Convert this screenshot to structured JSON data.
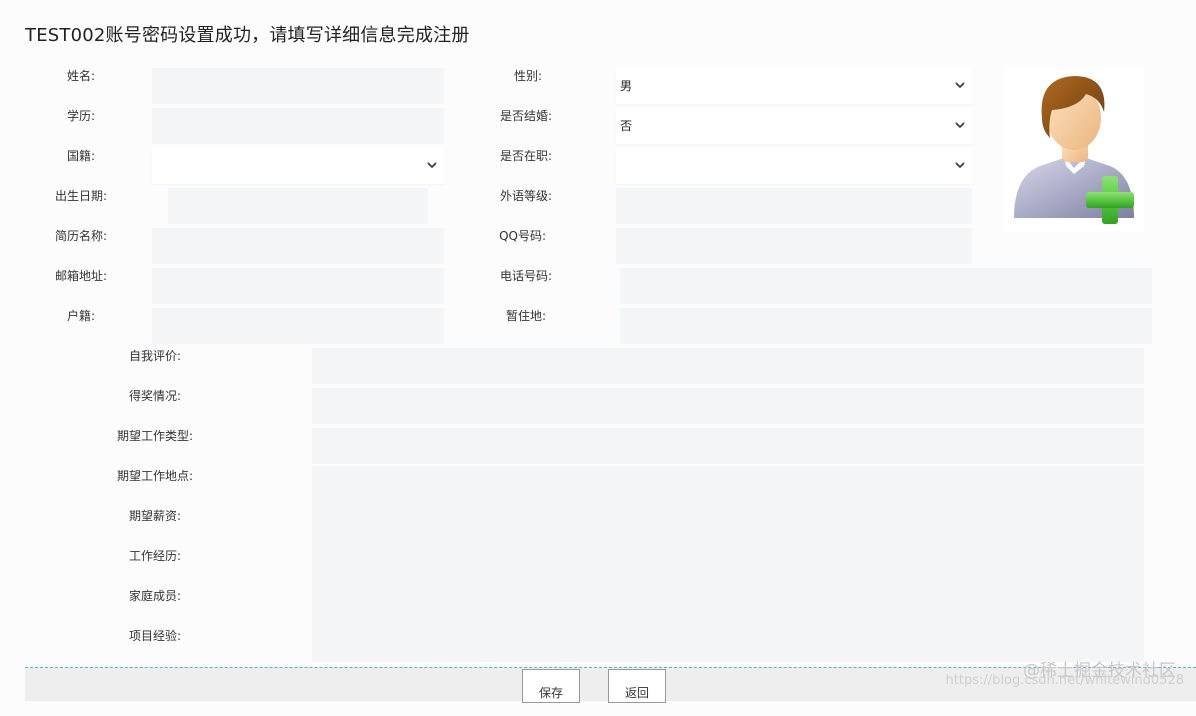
{
  "page": {
    "title": "TEST002账号密码设置成功，请填写详细信息完成注册"
  },
  "form": {
    "left_labels": {
      "name": "姓名:",
      "education": "学历:",
      "nationality": "国籍:",
      "birth_date": "出生日期:",
      "resume_name": "简历名称:",
      "email": "邮箱地址:",
      "household": "户籍:"
    },
    "right_labels": {
      "gender": "性别:",
      "married": "是否结婚:",
      "employed": "是否在职:",
      "language_level": "外语等级:",
      "qq": "QQ号码:",
      "phone": "电话号码:",
      "residence": "暂住地:"
    },
    "selects": {
      "gender": "男",
      "married": "否",
      "nationality": "",
      "employed": ""
    },
    "lower_labels": {
      "self_eval": "自我评价:",
      "awards": "得奖情况:",
      "job_type": "期望工作类型:",
      "job_location": "期望工作地点:",
      "salary": "期望薪资:",
      "experience": "工作经历:",
      "family": "家庭成员:",
      "projects": "项目经验:"
    }
  },
  "avatar": {
    "icon": "add-user-avatar-icon",
    "colors": {
      "hair": "#8a4e12",
      "skin": "#f6cf9c",
      "shirt": "#a9abc6",
      "plus": "#4cc43a"
    }
  },
  "actions": {
    "save_label": "保存",
    "back_label": "返回"
  },
  "watermark": {
    "line1": "@稀土掘金技术社区",
    "line2": "https://blog.csdn.net/whitewind0528"
  }
}
